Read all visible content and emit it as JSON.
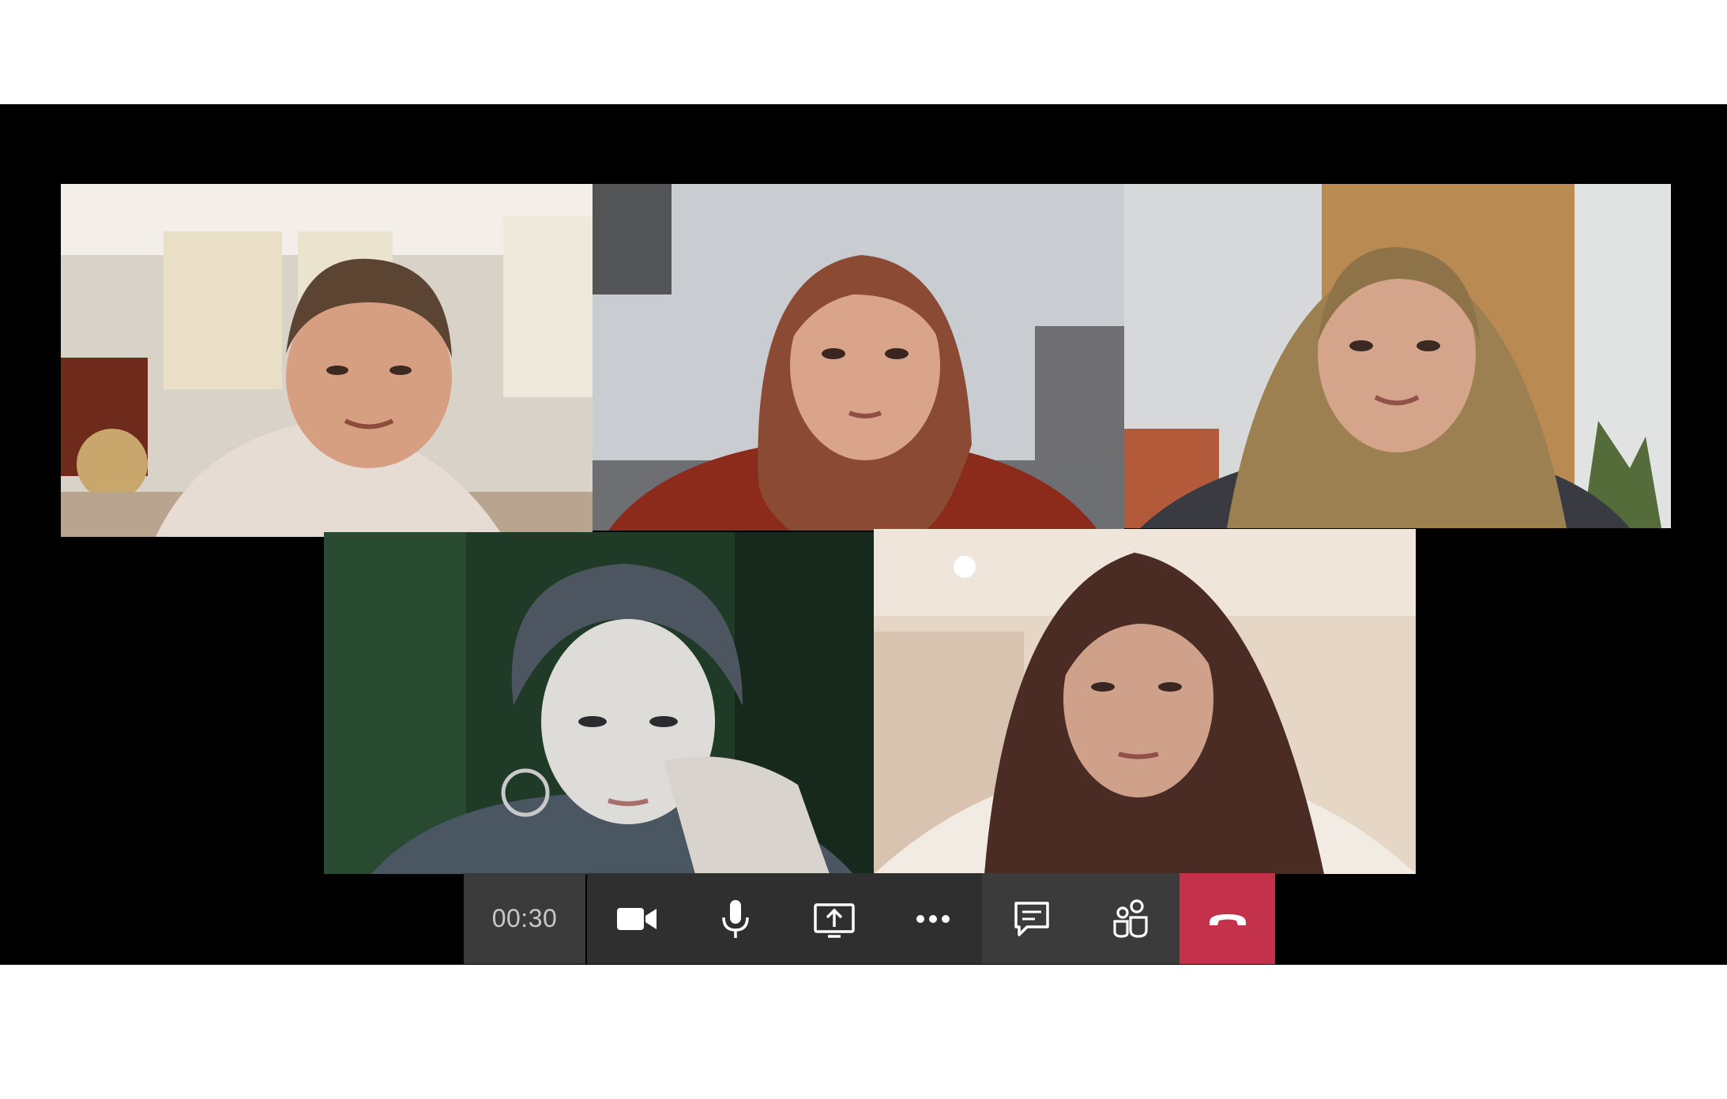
{
  "call": {
    "timer": "00:30",
    "participants": [
      {
        "tile": "participant-video-1"
      },
      {
        "tile": "participant-video-2"
      },
      {
        "tile": "participant-video-3"
      },
      {
        "tile": "participant-video-4"
      },
      {
        "tile": "participant-video-5"
      }
    ]
  },
  "toolbar": {
    "buttons": [
      {
        "name": "camera-button",
        "icon": "camera-icon"
      },
      {
        "name": "microphone-button",
        "icon": "microphone-icon"
      },
      {
        "name": "share-screen-button",
        "icon": "share-screen-icon"
      },
      {
        "name": "more-options-button",
        "icon": "more-options-icon"
      },
      {
        "name": "chat-button",
        "icon": "chat-icon"
      },
      {
        "name": "participants-button",
        "icon": "participants-icon"
      },
      {
        "name": "hang-up-button",
        "icon": "hang-up-icon"
      }
    ]
  },
  "colors": {
    "stage_background": "#000000",
    "toolbar_dark": "#2f2f2f",
    "toolbar_mid": "#3b3b3b",
    "hang_up": "#c4314b",
    "icon": "#ffffff",
    "timer_text": "#c8c8c8"
  }
}
